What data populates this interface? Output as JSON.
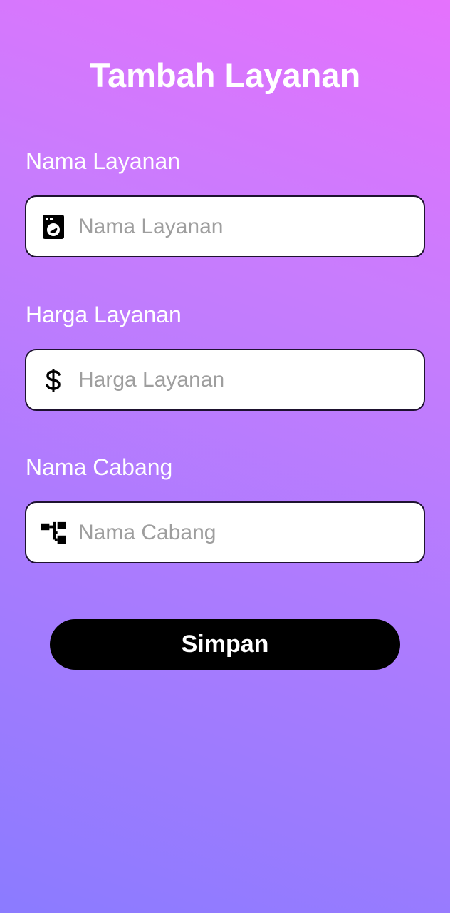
{
  "page": {
    "title": "Tambah Layanan",
    "background_gradient": [
      "#e572fd",
      "#8b7bff"
    ]
  },
  "form": {
    "fields": [
      {
        "label": "Nama Layanan",
        "placeholder": "Nama Layanan",
        "value": "",
        "icon": "washing-machine-icon"
      },
      {
        "label": "Harga Layanan",
        "placeholder": "Harga Layanan",
        "value": "",
        "icon": "dollar-icon"
      },
      {
        "label": "Nama Cabang",
        "placeholder": "Nama Cabang",
        "value": "",
        "icon": "branch-tree-icon"
      }
    ],
    "submit_label": "Simpan",
    "submit_color": "#000000"
  }
}
